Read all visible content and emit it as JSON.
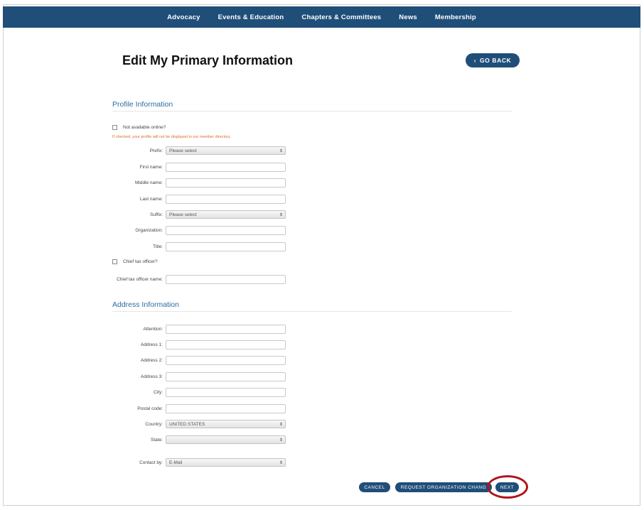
{
  "nav": {
    "items": [
      {
        "label": "Advocacy"
      },
      {
        "label": "Events & Education"
      },
      {
        "label": "Chapters & Committees"
      },
      {
        "label": "News"
      },
      {
        "label": "Membership"
      }
    ]
  },
  "page": {
    "title": "Edit My Primary Information",
    "go_back_label": "GO BACK"
  },
  "profile": {
    "section_title": "Profile Information",
    "not_available_label": "Not available online?",
    "not_available_note": "If checked, your profile will not be displayed in our member directory.",
    "prefix_label": "Prefix:",
    "prefix_value": "Please select",
    "first_name_label": "First name:",
    "middle_name_label": "Middle name:",
    "last_name_label": "Last name:",
    "suffix_label": "Suffix:",
    "suffix_value": "Please select",
    "organization_label": "Organization:",
    "title_label": "Title:",
    "chief_tax_label": "Chief tax officer?",
    "chief_tax_name_label": "Chief tax officer name:"
  },
  "address": {
    "section_title": "Address Information",
    "attention_label": "Attention:",
    "address1_label": "Address 1:",
    "address2_label": "Address 2:",
    "address3_label": "Address 3:",
    "city_label": "City:",
    "postal_label": "Postal code:",
    "country_label": "Country:",
    "country_value": "UNITED STATES",
    "state_label": "State:",
    "state_value": "",
    "contact_label": "Contact by:",
    "contact_value": "E-Mail"
  },
  "actions": {
    "cancel": "CANCEL",
    "request_org_change": "REQUEST ORGANIZATION CHANG",
    "next": "NEXT"
  },
  "colors": {
    "nav_bg": "#1f4e79",
    "section_title": "#2b6ca3",
    "warning_text": "#e06b2a",
    "highlight_ring": "#b0141c"
  }
}
